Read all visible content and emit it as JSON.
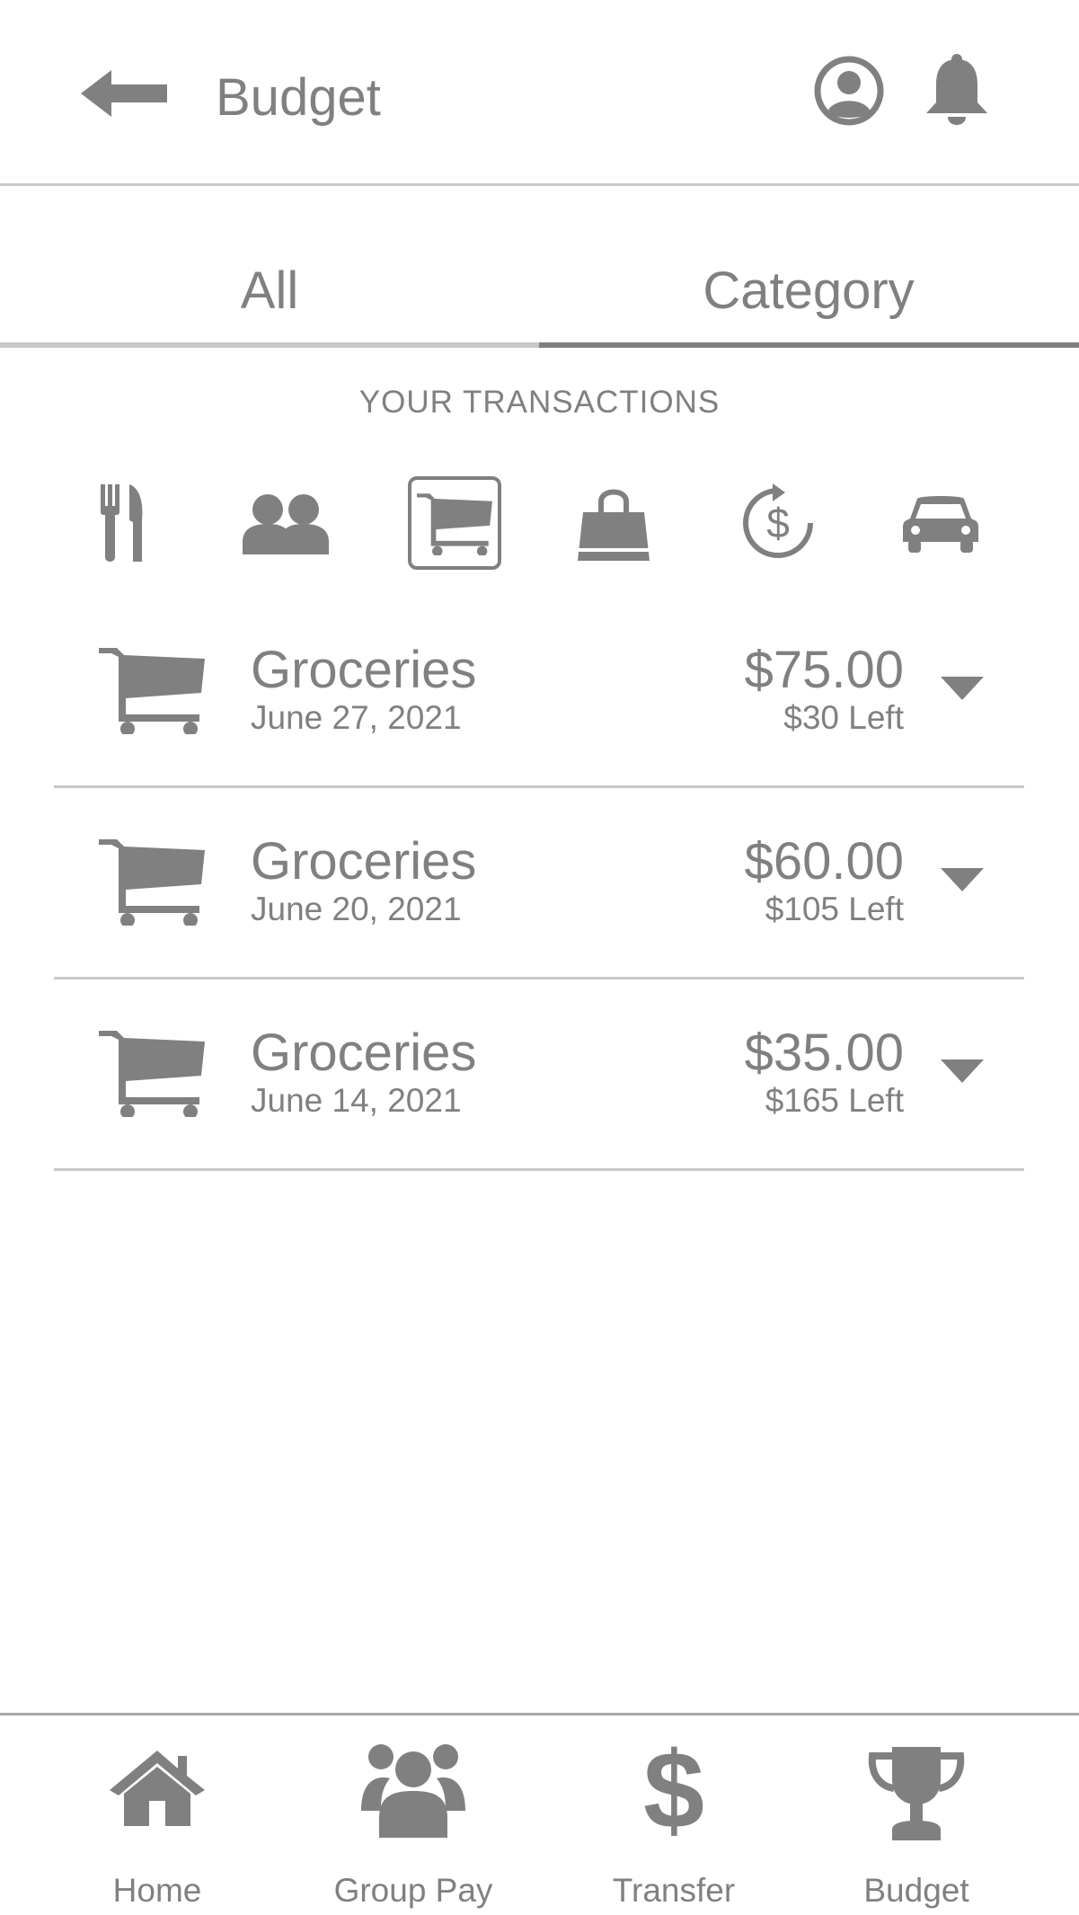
{
  "header": {
    "back_icon": "arrow-left-icon",
    "title": "Budget",
    "profile_icon": "user-circle-icon",
    "notifications_icon": "bell-icon"
  },
  "tabs": [
    {
      "label": "All",
      "active": false
    },
    {
      "label": "Category",
      "active": true
    }
  ],
  "section_title": "YOUR TRANSACTIONS",
  "categories": [
    {
      "icon": "utensils-icon",
      "selected": false
    },
    {
      "icon": "users-icon",
      "selected": false
    },
    {
      "icon": "cart-icon",
      "selected": true
    },
    {
      "icon": "shopping-bag-icon",
      "selected": false
    },
    {
      "icon": "dollar-refresh-icon",
      "selected": false
    },
    {
      "icon": "car-icon",
      "selected": false
    }
  ],
  "transactions": [
    {
      "icon": "cart-icon",
      "name": "Groceries",
      "date": "June 27, 2021",
      "amount": "$75.00",
      "remaining": "$30 Left"
    },
    {
      "icon": "cart-icon",
      "name": "Groceries",
      "date": "June 20, 2021",
      "amount": "$60.00",
      "remaining": "$105 Left"
    },
    {
      "icon": "cart-icon",
      "name": "Groceries",
      "date": "June 14, 2021",
      "amount": "$35.00",
      "remaining": "$165 Left"
    }
  ],
  "bottom_nav": [
    {
      "icon": "home-icon",
      "label": "Home"
    },
    {
      "icon": "group-icon",
      "label": "Group Pay"
    },
    {
      "icon": "dollar-icon",
      "label": "Transfer"
    },
    {
      "icon": "trophy-icon",
      "label": "Budget"
    }
  ],
  "colors": {
    "primary_gray": "#808080",
    "divider": "#c8c8c8",
    "background": "#ffffff"
  }
}
